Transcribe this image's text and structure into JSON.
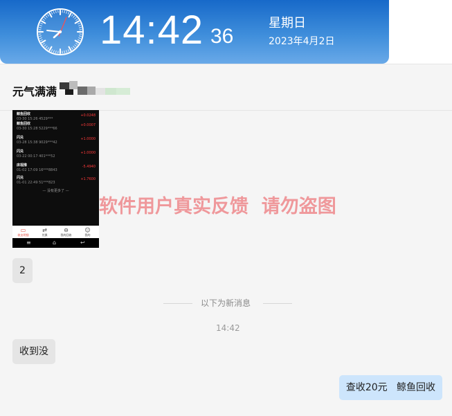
{
  "clock": {
    "time": "14:42",
    "seconds": "36",
    "weekday": "星期日",
    "date": "2023年4月2日",
    "analog_icon": "analog-clock-icon"
  },
  "chat": {
    "contact_name": "元气满满",
    "image_message": {
      "rows": [
        {
          "name": "鲸鱼回收",
          "meta": "03-30 15:26 4529***",
          "amount": "+0.0248"
        },
        {
          "name": "鲸鱼回收",
          "meta": "03-30 15:28 5229***66",
          "amount": "+0.0007"
        },
        {
          "name": "闪兑",
          "meta": "03-28 15:38 9029***42",
          "amount": "+1.0000"
        },
        {
          "name": "闪兑",
          "meta": "03-22 00:17 401***52",
          "amount": "+1.0000"
        },
        {
          "name": "床视推",
          "meta": "01-02 17:09 16***8843",
          "amount": "-5.4940"
        },
        {
          "name": "闪兑",
          "meta": "01-01 22:49 51***823",
          "amount": "+1.7600"
        }
      ],
      "no_more_text": "没有更多了",
      "nav": [
        {
          "label": "收支明细",
          "icon": "wallet-icon"
        },
        {
          "label": "兑换",
          "icon": "exchange-icon"
        },
        {
          "label": "我的回收",
          "icon": "recycle-icon"
        },
        {
          "label": "我的",
          "icon": "user-icon"
        }
      ]
    },
    "watermark": "软件用户真实反馈  请勿盗图",
    "messages": {
      "first": "2",
      "second": "收到没",
      "sent": "查收20元   鲸鱼回收"
    },
    "new_messages_label": "以下为新消息",
    "timestamp": "14:42"
  }
}
